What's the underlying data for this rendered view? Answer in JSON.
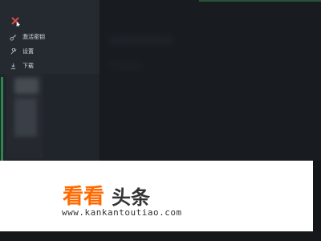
{
  "sidebar": {
    "items": [
      {
        "label": "激活密钥",
        "icon": "key-icon"
      },
      {
        "label": "设置",
        "icon": "wrench-icon"
      },
      {
        "label": "下载",
        "icon": "download-icon"
      }
    ],
    "close_icon": "close-icon"
  },
  "watermark": {
    "brand_orange": "看看",
    "brand_dark": "头条",
    "url": "www.kankantoutiao.com"
  },
  "colors": {
    "sidebar_bg": "#20242b",
    "panel_bg": "#181b20",
    "accent_red": "#d84b47",
    "accent_green": "#2f9f57",
    "watermark_orange": "#ff6a00"
  }
}
